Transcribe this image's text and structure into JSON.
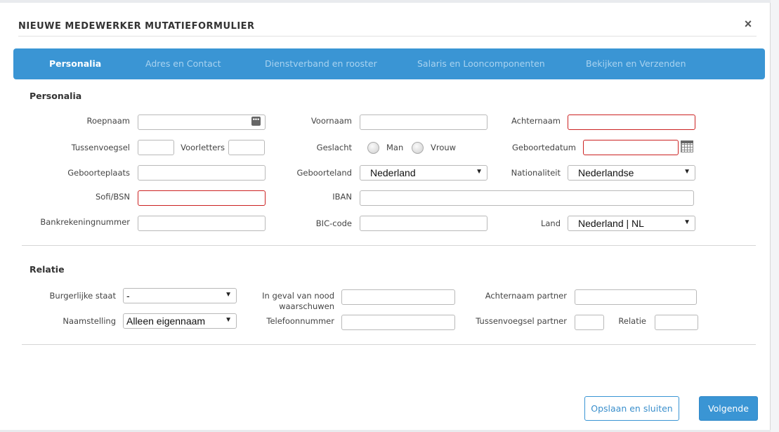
{
  "modal": {
    "title": "NIEUWE MEDEWERKER MUTATIEFORMULIER",
    "close_symbol": "×"
  },
  "tabs": [
    {
      "label": "Personalia",
      "active": true
    },
    {
      "label": "Adres en Contact",
      "active": false
    },
    {
      "label": "Dienstverband en rooster",
      "active": false
    },
    {
      "label": "Salaris en Looncomponenten",
      "active": false
    },
    {
      "label": "Bekijken en Verzenden",
      "active": false
    }
  ],
  "personalia": {
    "section_title": "Personalia",
    "labels": {
      "roepnaam": "Roepnaam",
      "voornaam": "Voornaam",
      "achternaam": "Achternaam",
      "tussenvoegsel": "Tussenvoegsel",
      "voorletters": "Voorletters",
      "geslacht": "Geslacht",
      "man": "Man",
      "vrouw": "Vrouw",
      "geboortedatum": "Geboortedatum",
      "geboorteplaats": "Geboorteplaats",
      "geboorteland": "Geboorteland",
      "nationaliteit": "Nationaliteit",
      "sofi": "Sofi/BSN",
      "iban": "IBAN",
      "bankrekeningnummer": "Bankrekeningnummer",
      "bic": "BIC-code",
      "land": "Land"
    },
    "values": {
      "roepnaam": "",
      "voornaam": "",
      "achternaam": "",
      "tussenvoegsel": "",
      "voorletters": "",
      "geboortedatum": "",
      "geboorteplaats": "",
      "sofi": "",
      "iban": "",
      "bankrekeningnummer": "",
      "bic": ""
    },
    "selects": {
      "geboorteland": "Nederland",
      "nationaliteit": "Nederlandse",
      "land": "Nederland | NL"
    }
  },
  "relatie": {
    "section_title": "Relatie",
    "labels": {
      "burgerlijke_staat": "Burgerlijke staat",
      "noodgeval_line1": "In geval van nood",
      "noodgeval_line2": "waarschuwen",
      "achternaam_partner": "Achternaam partner",
      "naamstelling": "Naamstelling",
      "telefoonnummer": "Telefoonnummer",
      "tussenvoegsel_partner": "Tussenvoegsel partner",
      "relatie": "Relatie"
    },
    "selects": {
      "burgerlijke_staat": "-",
      "naamstelling": "Alleen eigennaam"
    }
  },
  "footer": {
    "save_close_label": "Opslaan en sluiten",
    "next_label": "Volgende"
  },
  "colors": {
    "accent": "#3a95d4",
    "error_border": "#cc2222",
    "inactive_tab_text": "#a9d3f0"
  },
  "icons": {
    "dots": "ellipsis-icon",
    "calendar": "calendar-icon",
    "dropdown": "chevron-down-icon",
    "close": "close-icon"
  }
}
